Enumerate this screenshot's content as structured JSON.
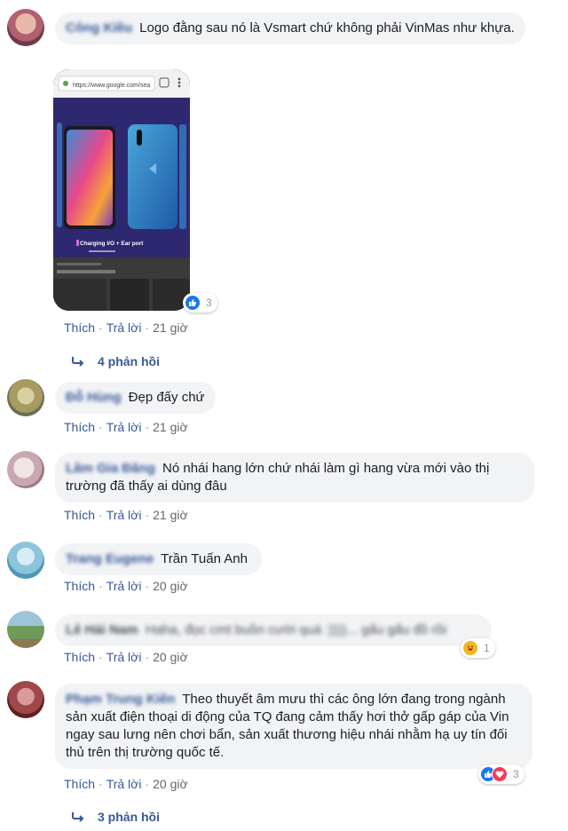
{
  "actions": {
    "like": "Thích",
    "reply": "Trả lời",
    "sep": "·"
  },
  "comments": [
    {
      "author": "Công Kiều",
      "text": "Logo đằng sau nó là Vsmart chứ không phải VinMas như khựa.",
      "time": "21 giờ",
      "image": {
        "url_bar": "https://www.google.com/sea",
        "caption": "Charging I/O + Ear port"
      },
      "reaction_count": "3",
      "replies": "4 phản hồi"
    },
    {
      "author": "Đỗ Hùng",
      "text": "Đẹp đấy chứ",
      "time": "21 giờ"
    },
    {
      "author": "Lâm Gia Đăng",
      "text": "Nó nhái hang lớn chứ nhái làm gì hang vừa mới vào thị trường đã thấy ai dùng đâu",
      "time": "21 giờ"
    },
    {
      "author": "Trang Eugene",
      "text": "Trần Tuấn Anh",
      "time": "20 giờ"
    },
    {
      "author": "Lê Hải Nam",
      "text": "Haha, đọc cmt buồn cười quá :))))... gấu gấu đồ rồi",
      "time": "20 giờ",
      "reaction_count": "1"
    },
    {
      "author": "Phạm Trung Kiên",
      "text": "Theo thuyết âm mưu thì các ông lớn đang trong ngành sản xuất điện thoại di động của TQ đang cảm thấy hơi thở gấp gáp của Vin ngay sau lưng nên chơi bẩn, sản xuất thương hiệu nhái nhằm hạ uy tín đối thủ trên thị trường quốc tế.",
      "time": "20 giờ",
      "reaction_count": "3",
      "replies": "3 phản hồi"
    }
  ],
  "colors": {
    "link": "#385898",
    "bubble": "#f2f3f5",
    "like_blue": "#1877f2",
    "love_red": "#f33e58",
    "haha_yellow": "#f7b125"
  }
}
